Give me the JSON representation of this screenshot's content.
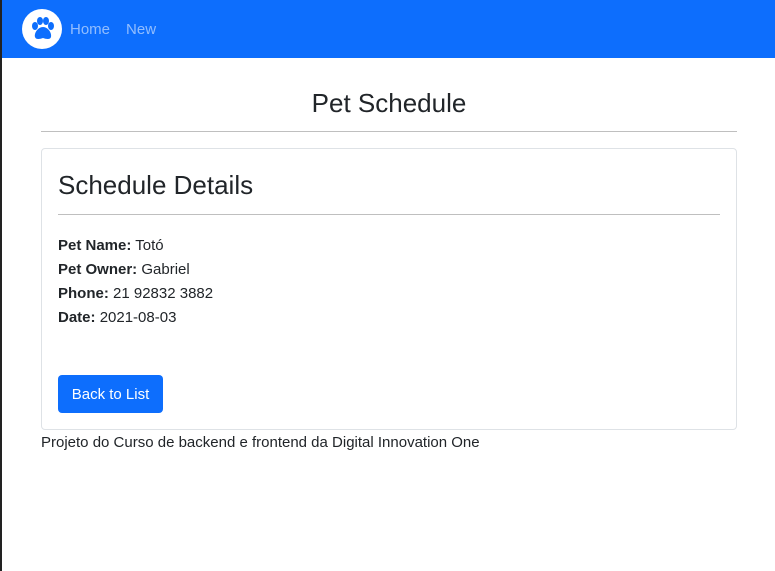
{
  "navbar": {
    "logo_icon": "paw-icon",
    "links": [
      "Home",
      "New"
    ],
    "background": "#0d6efd"
  },
  "page": {
    "title": "Pet Schedule"
  },
  "card": {
    "title": "Schedule Details",
    "fields": [
      {
        "label": "Pet Name:",
        "value": "Totó"
      },
      {
        "label": "Pet Owner:",
        "value": "Gabriel"
      },
      {
        "label": "Phone:",
        "value": "21 92832 3882"
      },
      {
        "label": "Date:",
        "value": "2021-08-03"
      }
    ],
    "back_button": "Back to List"
  },
  "footer": {
    "text": "Projeto do Curso de backend e frontend da Digital Innovation One"
  }
}
